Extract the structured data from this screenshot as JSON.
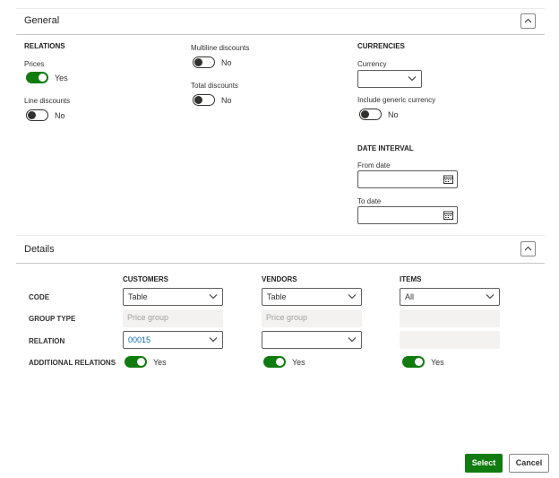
{
  "general": {
    "title": "General",
    "relations": {
      "header": "RELATIONS",
      "prices": {
        "label": "Prices",
        "value": "Yes"
      },
      "line_discounts": {
        "label": "Line discounts",
        "value": "No"
      },
      "multiline_discounts": {
        "label": "Multiline discounts",
        "value": "No"
      },
      "total_discounts": {
        "label": "Total discounts",
        "value": "No"
      }
    },
    "currencies": {
      "header": "CURRENCIES",
      "currency": {
        "label": "Currency",
        "value": ""
      },
      "include_generic": {
        "label": "Include generic currency",
        "value": "No"
      }
    },
    "date_interval": {
      "header": "DATE INTERVAL",
      "from_date": {
        "label": "From date",
        "value": ""
      },
      "to_date": {
        "label": "To date",
        "value": ""
      }
    }
  },
  "details": {
    "title": "Details",
    "columns": [
      "CUSTOMERS",
      "VENDORS",
      "ITEMS"
    ],
    "rows": {
      "code": "CODE",
      "group_type": "GROUP TYPE",
      "relation": "RELATION",
      "additional_relations": "ADDITIONAL RELATIONS"
    },
    "customers": {
      "code": "Table",
      "group_type_placeholder": "Price group",
      "relation": "00015",
      "additional": "Yes"
    },
    "vendors": {
      "code": "Table",
      "group_type_placeholder": "Price group",
      "relation": "",
      "additional": "Yes"
    },
    "items": {
      "code": "All",
      "group_type_placeholder": "",
      "relation": "",
      "additional": "Yes"
    }
  },
  "footer": {
    "select_label": "Select",
    "cancel_label": "Cancel"
  },
  "colors": {
    "accent": "#107c10",
    "link": "#0f6cbd",
    "border": "#605e5c",
    "readonly_bg": "#f3f2f1"
  },
  "icons": {
    "collapse": "chevron-up-icon",
    "dropdown": "chevron-down-icon",
    "date": "calendar-icon"
  }
}
